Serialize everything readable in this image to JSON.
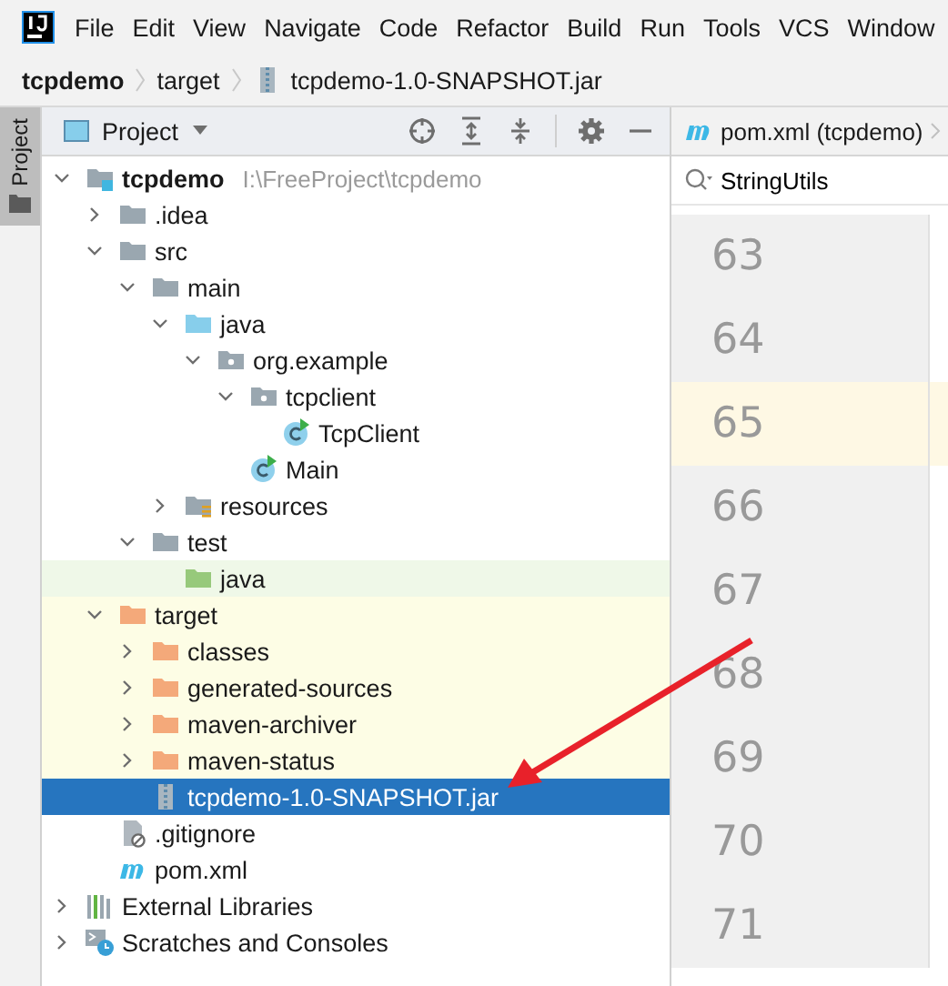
{
  "menu_bar": {
    "items": [
      "File",
      "Edit",
      "View",
      "Navigate",
      "Code",
      "Refactor",
      "Build",
      "Run",
      "Tools",
      "VCS",
      "Window"
    ]
  },
  "breadcrumb": [
    {
      "label": "tcpdemo",
      "kind": "module"
    },
    {
      "label": "target",
      "kind": "folder"
    },
    {
      "label": "tcpdemo-1.0-SNAPSHOT.jar",
      "kind": "jar"
    }
  ],
  "side_stripe": {
    "tabs": [
      {
        "label": "Project",
        "selected": true
      }
    ]
  },
  "project_panel": {
    "title": "Project",
    "tree": [
      {
        "label": "tcpdemo",
        "path": "I:\\FreeProject\\tcpdemo",
        "kind": "module",
        "expanded": true,
        "selected": false,
        "children": [
          {
            "label": ".idea",
            "kind": "folder",
            "expanded": false,
            "selected": false
          },
          {
            "label": "src",
            "kind": "folder",
            "expanded": true,
            "selected": false,
            "children": [
              {
                "label": "main",
                "kind": "folder",
                "expanded": true,
                "selected": false,
                "children": [
                  {
                    "label": "java",
                    "kind": "source",
                    "expanded": true,
                    "selected": false,
                    "children": [
                      {
                        "label": "org.example",
                        "kind": "package",
                        "expanded": true,
                        "selected": false,
                        "children": [
                          {
                            "label": "tcpclient",
                            "kind": "package",
                            "expanded": true,
                            "selected": false,
                            "children": [
                              {
                                "label": "TcpClient",
                                "kind": "class",
                                "selected": false
                              }
                            ]
                          },
                          {
                            "label": "Main",
                            "kind": "class",
                            "selected": false
                          }
                        ]
                      }
                    ]
                  },
                  {
                    "label": "resources",
                    "kind": "resources",
                    "expanded": false,
                    "selected": false
                  }
                ]
              },
              {
                "label": "test",
                "kind": "folder",
                "expanded": true,
                "selected": false,
                "children": [
                  {
                    "label": "java",
                    "kind": "test",
                    "selected": false
                  }
                ]
              }
            ]
          },
          {
            "label": "target",
            "kind": "excluded",
            "expanded": true,
            "selected": false,
            "children": [
              {
                "label": "classes",
                "kind": "excluded",
                "expanded": false,
                "selected": false
              },
              {
                "label": "generated-sources",
                "kind": "excluded",
                "expanded": false,
                "selected": false
              },
              {
                "label": "maven-archiver",
                "kind": "excluded",
                "expanded": false,
                "selected": false
              },
              {
                "label": "maven-status",
                "kind": "excluded",
                "expanded": false,
                "selected": false
              },
              {
                "label": "tcpdemo-1.0-SNAPSHOT.jar",
                "kind": "jar",
                "selected": true
              }
            ]
          },
          {
            "label": ".gitignore",
            "kind": "gitignore",
            "selected": false
          },
          {
            "label": "pom.xml",
            "kind": "maven",
            "selected": false
          }
        ]
      },
      {
        "label": "External Libraries",
        "kind": "libraries",
        "expanded": false,
        "selected": false
      },
      {
        "label": "Scratches and Consoles",
        "kind": "scratches",
        "expanded": false,
        "selected": false
      }
    ]
  },
  "editor": {
    "tab": {
      "label": "pom.xml (tcpdemo)",
      "kind": "maven"
    },
    "search": {
      "value": "StringUtils"
    },
    "lines": [
      {
        "number": "63",
        "current": false
      },
      {
        "number": "64",
        "current": false
      },
      {
        "number": "65",
        "current": true
      },
      {
        "number": "66",
        "current": false
      },
      {
        "number": "67",
        "current": false
      },
      {
        "number": "68",
        "current": false
      },
      {
        "number": "69",
        "current": false
      },
      {
        "number": "70",
        "current": false
      },
      {
        "number": "71",
        "current": false
      }
    ]
  },
  "annotation": {
    "kind": "arrow"
  }
}
